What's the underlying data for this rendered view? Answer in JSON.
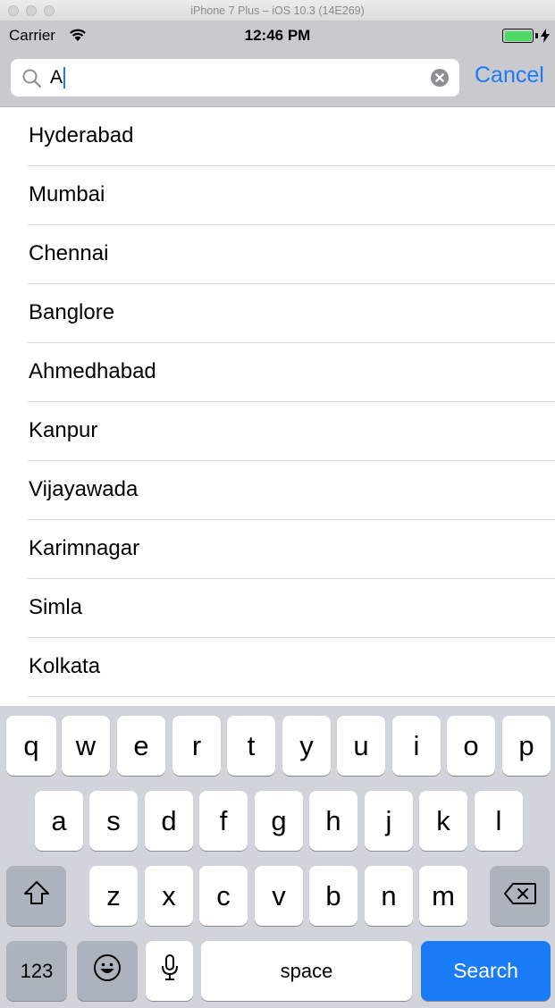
{
  "window": {
    "title": "iPhone 7 Plus – iOS 10.3 (14E269)"
  },
  "status_bar": {
    "carrier": "Carrier",
    "time": "12:46 PM",
    "battery_color": "#4cd964"
  },
  "search": {
    "query": "A",
    "cancel_label": "Cancel"
  },
  "cities": [
    "Hyderabad",
    "Mumbai",
    "Chennai",
    "Banglore",
    "Ahmedhabad",
    "Kanpur",
    "Vijayawada",
    "Karimnagar",
    "Simla",
    "Kolkata"
  ],
  "keyboard": {
    "row1": [
      "q",
      "w",
      "e",
      "r",
      "t",
      "y",
      "u",
      "i",
      "o",
      "p"
    ],
    "row2": [
      "a",
      "s",
      "d",
      "f",
      "g",
      "h",
      "j",
      "k",
      "l"
    ],
    "row3": [
      "z",
      "x",
      "c",
      "v",
      "b",
      "n",
      "m"
    ],
    "numbers_label": "123",
    "space_label": "space",
    "search_label": "Search",
    "accent_color": "#1a7bf7"
  }
}
